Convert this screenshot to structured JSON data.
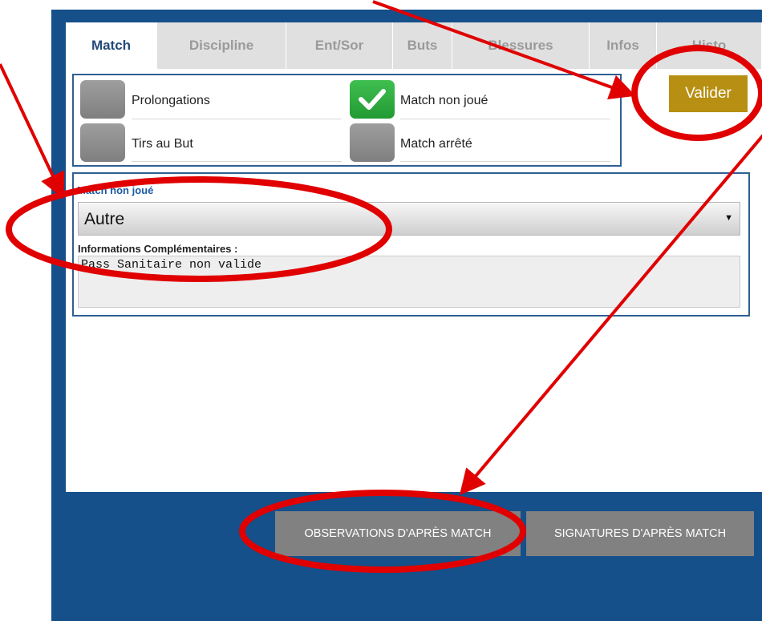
{
  "tabs": [
    {
      "label": "Match",
      "active": true
    },
    {
      "label": "Discipline",
      "active": false
    },
    {
      "label": "Ent/Sor",
      "active": false
    },
    {
      "label": "Buts",
      "active": false
    },
    {
      "label": "Blessures",
      "active": false
    },
    {
      "label": "Infos",
      "active": false
    },
    {
      "label": "Histo",
      "active": false
    }
  ],
  "options": {
    "prolongations": {
      "label": "Prolongations",
      "checked": false
    },
    "tirs_au_but": {
      "label": "Tirs au But",
      "checked": false
    },
    "match_non_joue": {
      "label": "Match non joué",
      "checked": true
    },
    "match_arrete": {
      "label": "Match arrêté",
      "checked": false
    }
  },
  "valider_label": "Valider",
  "non_joue_section": {
    "title": "Match non joué",
    "reason_selected": "Autre",
    "info_label": "Informations Complémentaires :",
    "info_value": "Pass Sanitaire non valide"
  },
  "footer": {
    "observations_label": "OBSERVATIONS D'APRÈS MATCH",
    "signatures_label": "SIGNATURES D'APRÈS MATCH"
  },
  "colors": {
    "frame": "#15508a",
    "valider": "#b78f12",
    "check": "#2aa93a",
    "annotation": "#e00000"
  }
}
